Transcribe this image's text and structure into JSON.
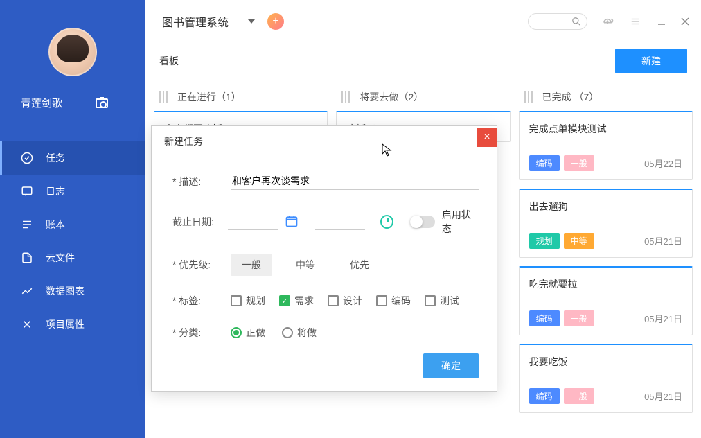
{
  "sidebar": {
    "username": "青莲剑歌",
    "nav": [
      {
        "label": "任务"
      },
      {
        "label": "日志"
      },
      {
        "label": "账本"
      },
      {
        "label": "云文件"
      },
      {
        "label": "数据图表"
      },
      {
        "label": "项目属性"
      }
    ]
  },
  "top": {
    "project": "图书管理系统"
  },
  "board": {
    "title": "看板",
    "new_btn": "新建",
    "columns": [
      {
        "title": "正在进行（1）"
      },
      {
        "title": "将要去做（2）"
      },
      {
        "title": "已完成 （7）"
      }
    ]
  },
  "col1_cards": [
    {
      "title": "人人都要吃饭"
    }
  ],
  "col2_cards": [
    {
      "title": "吃饭了"
    }
  ],
  "col3_cards": [
    {
      "title": "完成点单模块测试",
      "tag1": "编码",
      "tag2": "一般",
      "date": "05月22日",
      "t1class": "tag-coding",
      "t2class": "tag-normal"
    },
    {
      "title": "出去遛狗",
      "tag1": "规划",
      "tag2": "中等",
      "date": "05月21日",
      "t1class": "tag-planning",
      "t2class": "tag-medium"
    },
    {
      "title": "吃完就要拉",
      "tag1": "编码",
      "tag2": "一般",
      "date": "05月21日",
      "t1class": "tag-coding",
      "t2class": "tag-normal"
    },
    {
      "title": "我要吃饭",
      "tag1": "编码",
      "tag2": "一般",
      "date": "05月21日",
      "t1class": "tag-coding",
      "t2class": "tag-normal"
    }
  ],
  "modal": {
    "title": "新建任务",
    "desc_label": "描述:",
    "desc_value": "和客户再次谈需求",
    "deadline_label": "截止日期:",
    "enable_label": "启用状态",
    "priority_label": "优先级:",
    "priorities": [
      "一般",
      "中等",
      "优先"
    ],
    "tags_label": "标签:",
    "tags": [
      "规划",
      "需求",
      "设计",
      "编码",
      "测试"
    ],
    "category_label": "分类:",
    "categories": [
      "正做",
      "将做"
    ],
    "confirm": "确定"
  }
}
